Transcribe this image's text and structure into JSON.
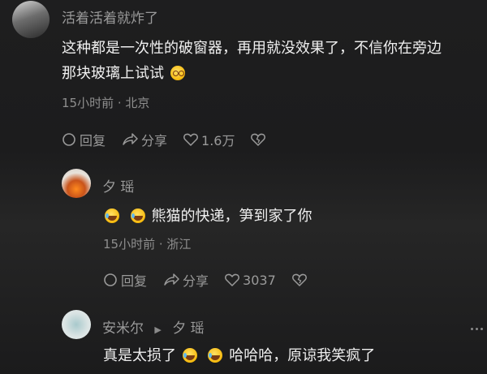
{
  "comments": [
    {
      "user": "活着活着就炸了",
      "text_line1": "这种都是一次性的破窗器，再用就没效果了，不信你在旁边",
      "text_line2": "那块玻璃上试试",
      "emoji": "dizzy-face",
      "meta": "15小时前 · 北京",
      "reply_label": "回复",
      "share_label": "分享",
      "like_count": "1.6万"
    },
    {
      "user": "夕 瑶",
      "text": "熊猫的快递，笋到家了你",
      "emojis": [
        "laughing-tears",
        "laughing-tears"
      ],
      "meta": "15小时前 · 浙江",
      "reply_label": "回复",
      "share_label": "分享",
      "like_count": "3037"
    },
    {
      "user": "安米尔",
      "reply_to": "夕 瑶",
      "text_a": "真是太损了",
      "text_b": "哈哈哈，原谅我笑疯了",
      "emojis": [
        "laughing-tears",
        "laughing-tears"
      ]
    }
  ]
}
